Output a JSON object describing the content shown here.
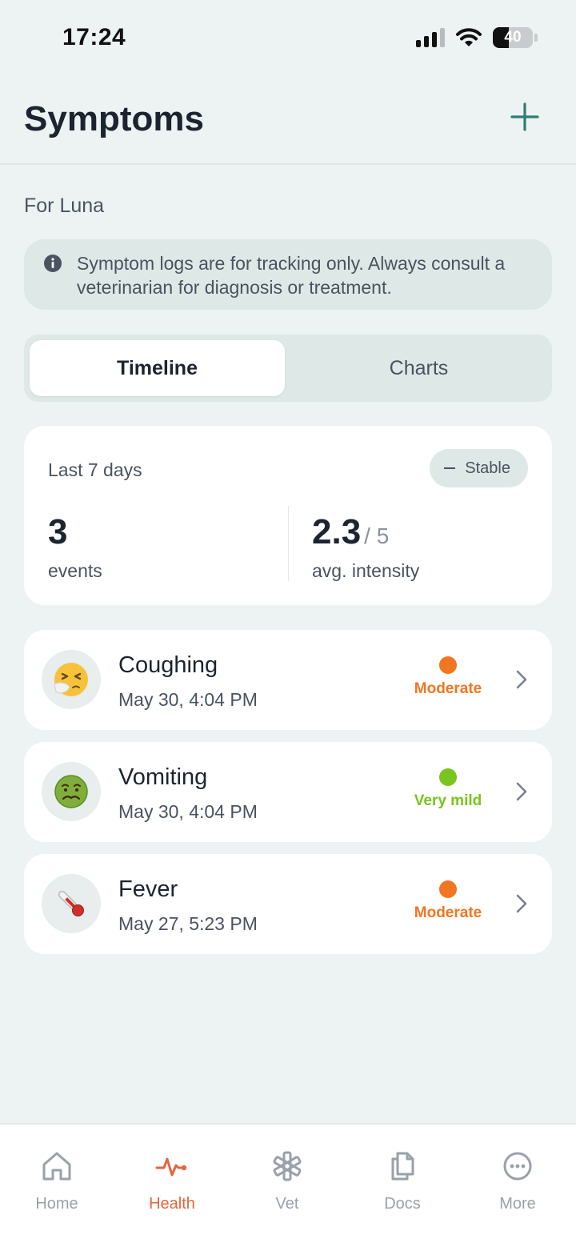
{
  "status_bar": {
    "time": "17:24",
    "battery_level": "40",
    "battery_fraction": 0.4,
    "icons": [
      "cellular-signal-icon",
      "wifi-icon",
      "battery-icon"
    ]
  },
  "header": {
    "title": "Symptoms",
    "add_icon": "plus-icon"
  },
  "subtitle": "For Luna",
  "disclaimer": {
    "icon": "info-icon",
    "text": "Symptom logs are for tracking only. Always consult a veterinarian for diagnosis or treatment."
  },
  "tabs": {
    "timeline": "Timeline",
    "charts": "Charts",
    "selected": "Timeline"
  },
  "summary": {
    "period": "Last 7 days",
    "trend": "Stable",
    "events_value": "3",
    "events_label": "events",
    "intensity_value": "2.3",
    "intensity_suffix": "/ 5",
    "intensity_label": "avg. intensity"
  },
  "symptoms": [
    {
      "name": "Coughing",
      "date": "May 30, 4:04 PM",
      "severity": "Moderate",
      "severity_color": "#f27520",
      "icon": "sneezing-face-icon"
    },
    {
      "name": "Vomiting",
      "date": "May 30, 4:04 PM",
      "severity": "Very mild",
      "severity_color": "#7ac41e",
      "icon": "nauseated-face-icon"
    },
    {
      "name": "Fever",
      "date": "May 27, 5:23 PM",
      "severity": "Moderate",
      "severity_color": "#f27520",
      "icon": "thermometer-icon"
    }
  ],
  "nav": [
    {
      "label": "Home",
      "icon": "home-icon",
      "active": false
    },
    {
      "label": "Health",
      "icon": "heartbeat-icon",
      "active": true
    },
    {
      "label": "Vet",
      "icon": "medical-star-icon",
      "active": false
    },
    {
      "label": "Docs",
      "icon": "documents-icon",
      "active": false
    },
    {
      "label": "More",
      "icon": "more-icon",
      "active": false
    }
  ],
  "colors": {
    "background": "#edf3f2",
    "accent": "#2e7d72",
    "active_tab": "#e5653f",
    "moderate": "#f27520",
    "very_mild": "#7ac41e"
  }
}
